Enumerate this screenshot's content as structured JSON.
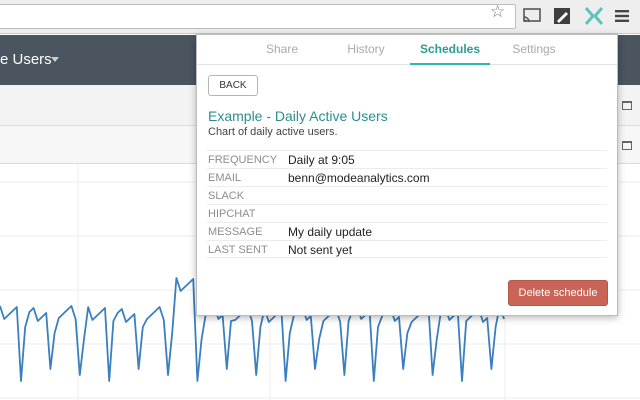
{
  "app": {
    "title": "e Users"
  },
  "popup": {
    "tabs": [
      {
        "label": "Share",
        "active": false
      },
      {
        "label": "History",
        "active": false
      },
      {
        "label": "Schedules",
        "active": true
      },
      {
        "label": "Settings",
        "active": false
      }
    ],
    "back_label": "BACK",
    "report_title": "Example - Daily Active Users",
    "report_description": "Chart of daily active users.",
    "details": [
      {
        "key": "FREQUENCY",
        "value": "Daily at 9:05"
      },
      {
        "key": "EMAIL",
        "value": "benn@modeanalytics.com"
      },
      {
        "key": "SLACK",
        "value": ""
      },
      {
        "key": "HIPCHAT",
        "value": ""
      },
      {
        "key": "MESSAGE",
        "value": "My daily update"
      },
      {
        "key": "LAST SENT",
        "value": "Not sent yet"
      }
    ],
    "delete_label": "Delete schedule"
  },
  "icons": [
    "star-icon",
    "cast-icon",
    "edit-icon",
    "mode-extension-icon",
    "menu-icon"
  ],
  "colors": {
    "accent": "#2fb5ac",
    "title": "#2c8e8e",
    "delete": "#c96456",
    "appbar": "#4a5560",
    "chart_line": "#3a7fbf"
  }
}
